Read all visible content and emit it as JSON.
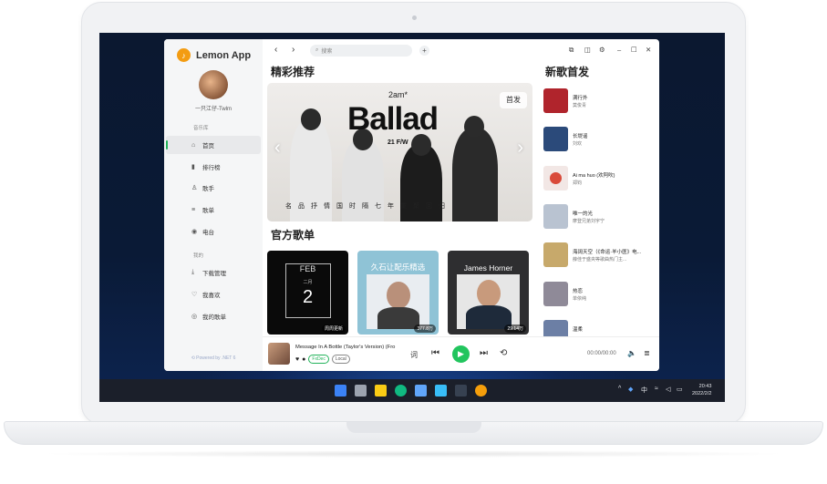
{
  "app": {
    "name": "Lemon App",
    "username": "一只江仔-Twlm",
    "powered_by": "Powered by .NET 6"
  },
  "sidebar": {
    "music_section": "音乐库",
    "mine_section": "我的",
    "items": [
      {
        "label": "首页",
        "icon": "home-icon",
        "glyph": "⌂"
      },
      {
        "label": "排行榜",
        "icon": "chart-icon",
        "glyph": "▮"
      },
      {
        "label": "歌手",
        "icon": "user-icon",
        "glyph": "♙"
      },
      {
        "label": "歌单",
        "icon": "playlist-icon",
        "glyph": "≡"
      },
      {
        "label": "电台",
        "icon": "radio-icon",
        "glyph": "◉"
      },
      {
        "label": "下载管理",
        "icon": "download-icon",
        "glyph": "⤓"
      },
      {
        "label": "我喜欢",
        "icon": "heart-icon",
        "glyph": "♡"
      },
      {
        "label": "我的歌单",
        "icon": "disc-icon",
        "glyph": "◎"
      }
    ]
  },
  "topbar": {
    "search_placeholder": "搜索"
  },
  "featured": {
    "title": "精彩推荐",
    "banner_logo": "2am*",
    "banner_title": "Ballad",
    "banner_sub": "21 F/W",
    "banner_caption": "名品抒情国时隔七年重聚回归",
    "banner_badge": "首发"
  },
  "playlists": {
    "title": "官方歌单",
    "items": [
      {
        "header": "FEB",
        "month": "二月",
        "day": "2",
        "count": "周周更新",
        "color": "#0a0a0a"
      },
      {
        "header": "久石让配乐精选",
        "count": "377.8万",
        "color": "#8fc3d6"
      },
      {
        "header": "James Horner",
        "count": "29.14万",
        "color": "#2e2e30"
      }
    ]
  },
  "new_songs": {
    "title": "新歌首发",
    "items": [
      {
        "title": "满行外",
        "artist": "莫俊青",
        "color": "#b0242c"
      },
      {
        "title": "长堤谣",
        "artist": "刘欢",
        "color": "#2b4a7a"
      },
      {
        "title": "Ai ma huo (欢阿吹)",
        "artist": "郑钧",
        "color": "#d94a3a"
      },
      {
        "title": "唯一的光",
        "artist": "摩登兄弟刘宇宁",
        "color": "#b9c3d1"
      },
      {
        "title": "海阔天空（《命运·羊小医》电...",
        "artist": "薛佳于盛央等歌曲热门主...",
        "color": "#c7a96b"
      },
      {
        "title": "热恋",
        "artist": "单依纯",
        "color": "#8f8a98"
      },
      {
        "title": "温柔",
        "artist": "",
        "color": "#6c7fa5"
      }
    ]
  },
  "player": {
    "title": "Message In A Bottle (Taylor's Version) (Fro",
    "tag1": "FxDec",
    "tag2": "Local",
    "lyrics_label": "词",
    "time": "00:00/00:00"
  },
  "taskbar": {
    "ime": "中",
    "time": "20:43",
    "date": "2022/2/2"
  }
}
